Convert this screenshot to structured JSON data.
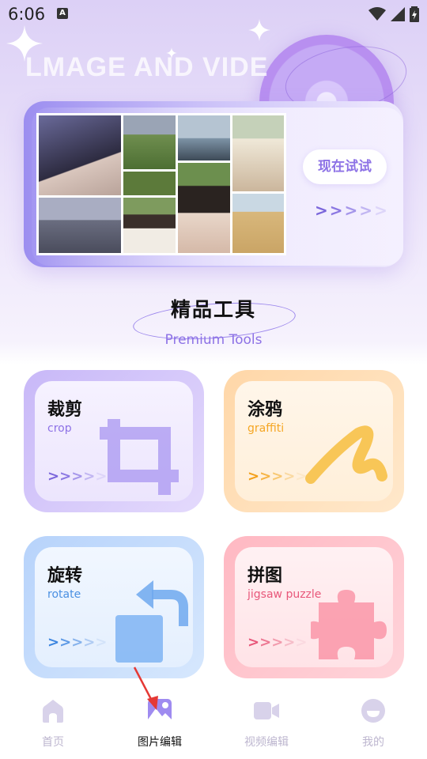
{
  "status_bar": {
    "time": "6:06",
    "a_badge": "A"
  },
  "hero": {
    "title": "LMAGE AND VIDE",
    "try_button": "现在试试",
    "arrows": [
      ">",
      ">",
      ">",
      ">",
      ">"
    ]
  },
  "section": {
    "title": "精品工具",
    "subtitle": "Premium Tools"
  },
  "tools": [
    {
      "title": "裁剪",
      "subtitle": "crop",
      "accent": "#8d72e6"
    },
    {
      "title": "涂鸦",
      "subtitle": "graffiti",
      "accent": "#f5a623"
    },
    {
      "title": "旋转",
      "subtitle": "rotate",
      "accent": "#4a90e2"
    },
    {
      "title": "拼图",
      "subtitle": "jigsaw puzzle",
      "accent": "#e8577a"
    }
  ],
  "tool_arrows": [
    ">",
    ">",
    ">",
    ">",
    ">"
  ],
  "nav": {
    "items": [
      {
        "label": "首页",
        "icon": "home-icon",
        "active": false
      },
      {
        "label": "图片编辑",
        "icon": "image-icon",
        "active": true
      },
      {
        "label": "视频编辑",
        "icon": "video-camera-icon",
        "active": false
      },
      {
        "label": "我的",
        "icon": "profile-face-icon",
        "active": false
      }
    ]
  },
  "colors": {
    "accent": "#8d72e6",
    "nav_inactive": "#d8d2ea",
    "nav_active": "#9f8bf0",
    "annotation": "#e53935"
  }
}
